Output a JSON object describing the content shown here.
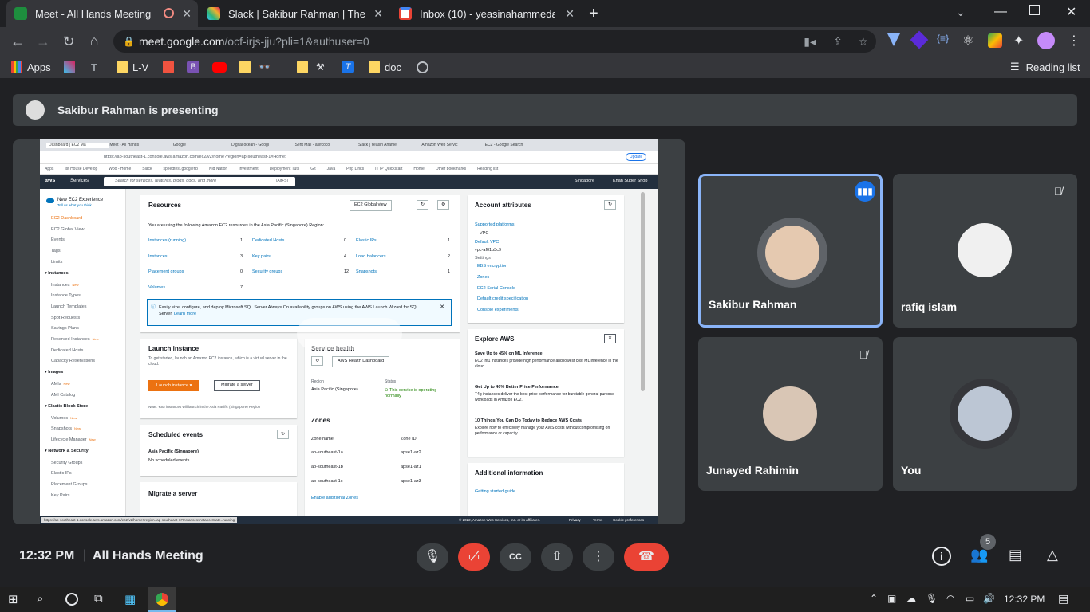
{
  "browser": {
    "tabs": [
      {
        "title": "Meet - All Hands Meeting",
        "color": "#1e8e3e"
      },
      {
        "title": "Slack | Sakibur Rahman | The Tech",
        "color": "#4a154b"
      },
      {
        "title": "Inbox (10) - yeasinahammedapon",
        "color": "#ea4335"
      }
    ],
    "url_host": "meet.google.com",
    "url_path": "/ocf-irjs-jju?pli=1&authuser=0",
    "bookmarks": [
      "Apps",
      "L-V",
      "B",
      "doc"
    ],
    "reading_list": "Reading list"
  },
  "meet": {
    "presenting_text": "Sakibur Rahman is presenting",
    "time": "12:32 PM",
    "meeting_title": "All Hands Meeting",
    "participant_count": "5",
    "participants": [
      {
        "name": "Sakibur Rahman"
      },
      {
        "name": "rafiq islam"
      },
      {
        "name": "Junayed Rahimin"
      },
      {
        "name": "You"
      }
    ]
  },
  "shared_screen": {
    "tabs": [
      "Dashboard | EC2 Ma",
      "Meet - All Hands",
      "Google",
      "Digital ocean - Googl",
      "Sent Mail - asifcoco",
      "Slack | Yeasin Ahame",
      "Amazon Web Servic",
      "EC2 - Google Search"
    ],
    "url": "https://ap-southeast-1.console.aws.amazon.com/ec2/v2/home?region=ap-southeast-1#Home:",
    "update": "Update",
    "bookmarks": [
      "Apps",
      "Ist House Develop",
      "Woo - Home",
      "Slack",
      "speedtest.googlefib",
      "Nid Nation",
      "Investment",
      "Deployment Tuts",
      "Git",
      "Java",
      "Php Links",
      "IT IP Quickstart",
      "Home",
      "Other bookmarks",
      "Reading list"
    ],
    "aws": {
      "services": "Services",
      "search_placeholder": "Search for services, features, blogs, docs, and more",
      "shortcut": "[Alt+S]",
      "region": "Singapore",
      "account": "Khan Super Shop",
      "new_ec2": "New EC2 Experience",
      "new_ec2_sub": "Tell us what you think",
      "sidebar": [
        {
          "label": "EC2 Dashboard",
          "active": true
        },
        {
          "label": "EC2 Global View"
        },
        {
          "label": "Events"
        },
        {
          "label": "Tags"
        },
        {
          "label": "Limits"
        },
        {
          "label": "Instances",
          "heading": true
        },
        {
          "label": "Instances",
          "new": true
        },
        {
          "label": "Instance Types"
        },
        {
          "label": "Launch Templates"
        },
        {
          "label": "Spot Requests"
        },
        {
          "label": "Savings Plans"
        },
        {
          "label": "Reserved Instances",
          "new": true
        },
        {
          "label": "Dedicated Hosts"
        },
        {
          "label": "Capacity Reservations"
        },
        {
          "label": "Images",
          "heading": true
        },
        {
          "label": "AMIs",
          "new": true
        },
        {
          "label": "AMI Catalog"
        },
        {
          "label": "Elastic Block Store",
          "heading": true
        },
        {
          "label": "Volumes",
          "new": true
        },
        {
          "label": "Snapshots",
          "new": true
        },
        {
          "label": "Lifecycle Manager",
          "new": true
        },
        {
          "label": "Network & Security",
          "heading": true
        },
        {
          "label": "Security Groups"
        },
        {
          "label": "Elastic IPs"
        },
        {
          "label": "Placement Groups"
        },
        {
          "label": "Key Pairs"
        }
      ],
      "new_badge": "New",
      "resources_title": "Resources",
      "global_view_btn": "EC2 Global view",
      "resources_intro": "You are using the following Amazon EC2 resources in the Asia Pacific (Singapore) Region:",
      "resources": [
        [
          "Instances (running)",
          "1",
          "Dedicated Hosts",
          "0",
          "Elastic IPs",
          "1"
        ],
        [
          "Instances",
          "3",
          "Key pairs",
          "4",
          "Load balancers",
          "2"
        ],
        [
          "Placement groups",
          "0",
          "Security groups",
          "12",
          "Snapshots",
          "1"
        ],
        [
          "Volumes",
          "7",
          "",
          "",
          "",
          ""
        ]
      ],
      "sql_info": "Easily size, configure, and deploy Microsoft SQL Server Always On availability groups on AWS using the AWS Launch Wizard for SQL Server.",
      "learn_more": "Learn more",
      "launch_title": "Launch instance",
      "launch_desc": "To get started, launch an Amazon EC2 instance, which is a virtual server in the cloud.",
      "launch_btn": "Launch instance",
      "migrate_btn": "Migrate a server",
      "launch_note": "Note: Your instances will launch in the Asia Pacific (Singapore) Region",
      "health_title": "Service health",
      "health_btn": "AWS Health Dashboard",
      "region_label": "Region",
      "region_value": "Asia Pacific (Singapore)",
      "status_label": "Status",
      "status_value": "This service is operating normally",
      "zones_title": "Zones",
      "zone_name_h": "Zone name",
      "zone_id_h": "Zone ID",
      "zones": [
        [
          "ap-southeast-1a",
          "apse1-az2"
        ],
        [
          "ap-southeast-1b",
          "apse1-az1"
        ],
        [
          "ap-southeast-1c",
          "apse1-az3"
        ]
      ],
      "enable_zones": "Enable additional Zones",
      "sched_title": "Scheduled events",
      "sched_region": "Asia Pacific (Singapore)",
      "sched_none": "No scheduled events",
      "migrate_title": "Migrate a server",
      "acct_title": "Account attributes",
      "acct_items": [
        "Supported platforms",
        "VPC",
        "Default VPC",
        "vpc-af01b3c9",
        "Settings",
        "EBS encryption",
        "Zones",
        "EC2 Serial Console",
        "Default credit specification",
        "Console experiments"
      ],
      "explore_title": "Explore AWS",
      "explore": [
        {
          "title": "Save Up to 45% on ML Inference",
          "body": "EC2 Inf1 instances provide high performance and lowest cost ML inference in the cloud."
        },
        {
          "title": "Get Up to 40% Better Price Performance",
          "body": "T4g instances deliver the best price performance for burstable general purpose workloads in Amazon EC2."
        },
        {
          "title": "10 Things You Can Do Today to Reduce AWS Costs",
          "body": "Explore how to effectively manage your AWS costs without compromising on performance or capacity."
        }
      ],
      "additional_title": "Additional information",
      "getting_started": "Getting started guide",
      "footer": "© 2022, Amazon Web Services, Inc. or its affiliates.",
      "footer_links": [
        "Privacy",
        "Terms",
        "Cookie preferences"
      ],
      "status_url": "https://ap-southeast-1.console.aws.amazon.com/ec2/v2/home?region=ap-southeast-1#Instances:instanceState=running"
    }
  },
  "taskbar": {
    "time": "12:32 PM"
  }
}
